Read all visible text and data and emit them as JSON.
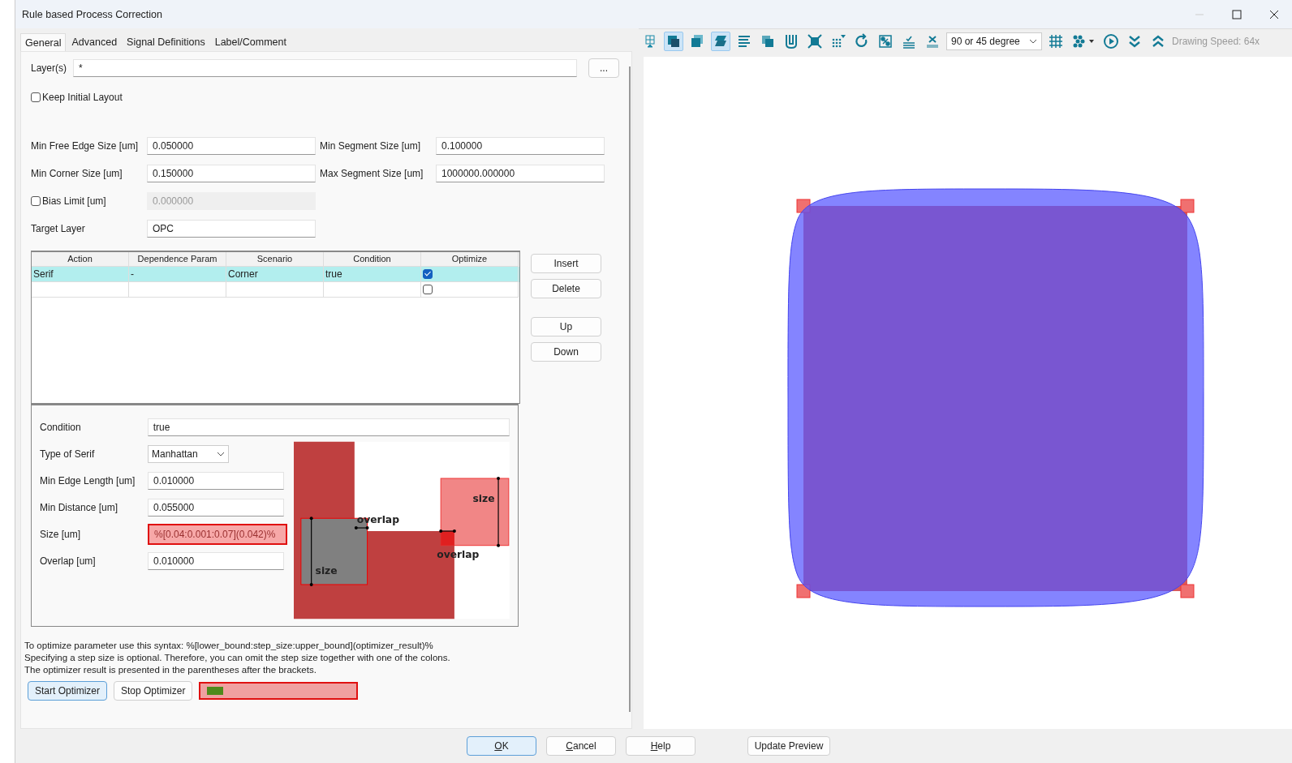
{
  "window": {
    "title": "Rule based Process Correction"
  },
  "tabs": [
    {
      "label": "General",
      "selected": true
    },
    {
      "label": "Advanced",
      "selected": false
    },
    {
      "label": "Signal Definitions",
      "selected": false
    },
    {
      "label": "Label/Comment",
      "selected": false
    }
  ],
  "layers": {
    "label": "Layer(s)",
    "value": "*",
    "browse": "..."
  },
  "keep_initial_layout": {
    "label": "Keep Initial Layout",
    "checked": false
  },
  "params": [
    {
      "label": "Min Free Edge Size [um]",
      "value": "0.050000"
    },
    {
      "label": "Min Segment Size [um]",
      "value": "0.100000"
    },
    {
      "label": "Min Corner Size [um]",
      "value": "0.150000"
    },
    {
      "label": "Max Segment Size [um]",
      "value": "1000000.000000"
    }
  ],
  "bias_limit": {
    "label": "Bias Limit [um]",
    "checked": false,
    "value": "0.000000",
    "disabled": true
  },
  "target_layer": {
    "label": "Target Layer",
    "value": "OPC"
  },
  "table": {
    "columns": [
      "Action",
      "Dependence Param",
      "Scenario",
      "Condition",
      "Optimize"
    ],
    "rows": [
      {
        "cells": [
          "Serif",
          "-",
          "Corner",
          "true"
        ],
        "optimize": true,
        "selected": true
      },
      {
        "cells": [
          "",
          "",
          "",
          ""
        ],
        "optimize": false,
        "selected": false
      }
    ]
  },
  "table_buttons": [
    "Insert",
    "Delete",
    "Up",
    "Down"
  ],
  "details": {
    "fields": [
      {
        "kind": "text",
        "label": "Condition",
        "value": "true",
        "flagged": false
      },
      {
        "kind": "select",
        "label": "Type of Serif",
        "value": "Manhattan",
        "flagged": false
      },
      {
        "kind": "short",
        "label": "Min Edge Length [um]",
        "value": "0.010000",
        "flagged": false
      },
      {
        "kind": "short",
        "label": "Min Distance [um]",
        "value": "0.055000",
        "flagged": false
      },
      {
        "kind": "short",
        "label": "Size [um]",
        "value": "%[0.04:0.001:0.07](0.042)%",
        "flagged": true
      },
      {
        "kind": "short",
        "label": "Overlap [um]",
        "value": "0.010000",
        "flagged": false
      }
    ],
    "diagram_labels": [
      "overlap",
      "size",
      "overlap",
      "size"
    ]
  },
  "help_lines": [
    "To optimize parameter use this syntax: %[lower_bound:step_size:upper_bound](optimizer_result)%",
    "Specifying a step size is optional. Therefore, you can omit the step size together with one of the colons.",
    "The optimizer result is presented in the parentheses after the brackets."
  ],
  "optimizer": {
    "start": "Start Optimizer",
    "stop": "Stop Optimizer",
    "level": 0.11,
    "flagged": true
  },
  "toolbar": {
    "buttons": [
      {
        "selected": false
      },
      {
        "selected": true
      },
      {
        "selected": false
      },
      {
        "selected": true
      },
      {
        "selected": false
      },
      {
        "selected": false
      },
      {
        "selected": false
      },
      {
        "selected": false
      },
      {
        "selected": false
      },
      {
        "selected": false
      },
      {
        "selected": false
      },
      {
        "selected": false
      },
      {
        "selected": false
      }
    ],
    "angle": "90 or 45 degree",
    "tail": [
      {
        "selected": false
      },
      {
        "selected": false
      },
      {
        "selected": false
      },
      {
        "selected": false
      },
      {
        "selected": false
      }
    ],
    "speed": "Drawing Speed: 64x"
  },
  "footer_buttons": [
    {
      "label": "OK",
      "default": true
    },
    {
      "label": "Cancel",
      "default": false
    },
    {
      "label": "Help",
      "default": false
    }
  ],
  "update_preview": "Update Preview"
}
